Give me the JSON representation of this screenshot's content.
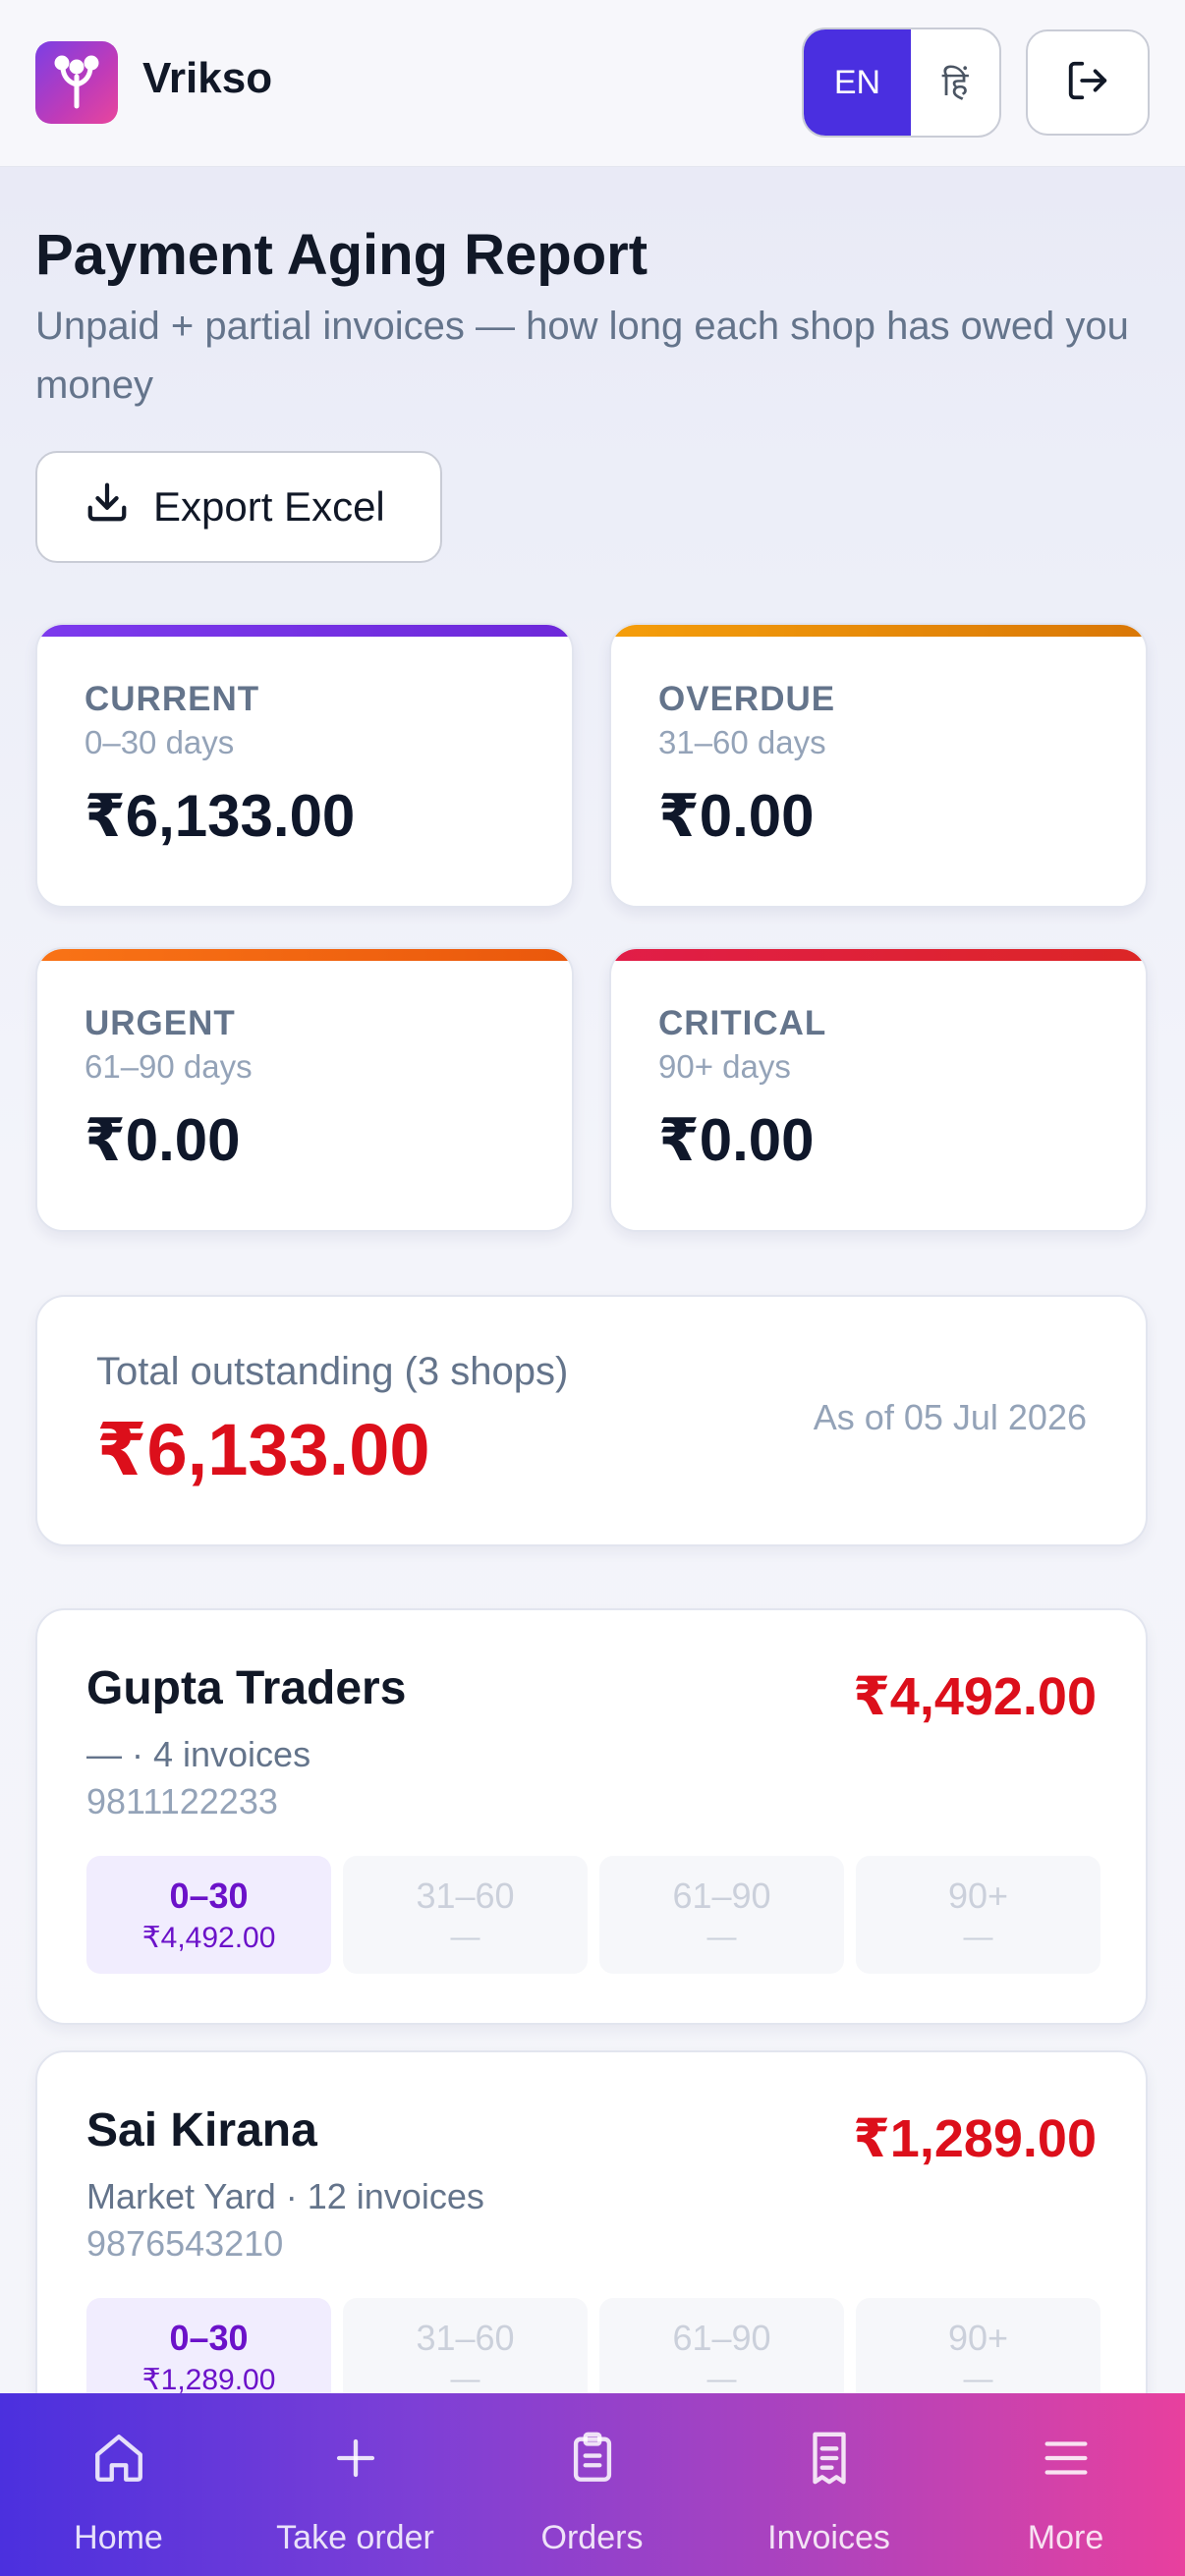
{
  "header": {
    "app_name": "Vrikso",
    "lang_en": "EN",
    "lang_hi": "हिं",
    "logo_icon": "tree-icon",
    "logout_icon": "logout-icon"
  },
  "page": {
    "title": "Payment Aging Report",
    "subtitle": "Unpaid + partial invoices — how long each shop has owed you money",
    "export_label": "Export Excel",
    "export_icon": "download-icon"
  },
  "buckets": [
    {
      "label": "CURRENT",
      "range": "0–30 days",
      "amount": "₹6,133.00",
      "color": "#7c3aed"
    },
    {
      "label": "OVERDUE",
      "range": "31–60 days",
      "amount": "₹0.00",
      "color": "#f59e0b"
    },
    {
      "label": "URGENT",
      "range": "61–90 days",
      "amount": "₹0.00",
      "color": "#f97316"
    },
    {
      "label": "CRITICAL",
      "range": "90+ days",
      "amount": "₹0.00",
      "color": "#e11d48"
    }
  ],
  "total": {
    "label": "Total outstanding (3 shops)",
    "amount": "₹6,133.00",
    "as_of": "As of 05 Jul 2026"
  },
  "shops": [
    {
      "name": "Gupta Traders",
      "amount": "₹4,492.00",
      "meta": "— · 4 invoices",
      "phone": "9811122233",
      "aging": [
        {
          "title": "0–30",
          "value": "₹4,492.00"
        },
        {
          "title": "31–60",
          "value": "—"
        },
        {
          "title": "61–90",
          "value": "—"
        },
        {
          "title": "90+",
          "value": "—"
        }
      ]
    },
    {
      "name": "Sai Kirana",
      "amount": "₹1,289.00",
      "meta": "Market Yard · 12 invoices",
      "phone": "9876543210",
      "aging": [
        {
          "title": "0–30",
          "value": "₹1,289.00"
        },
        {
          "title": "31–60",
          "value": "—"
        },
        {
          "title": "61–90",
          "value": "—"
        },
        {
          "title": "90+",
          "value": "—"
        }
      ]
    }
  ],
  "nav": [
    {
      "label": "Home",
      "icon": "home-icon"
    },
    {
      "label": "Take order",
      "icon": "plus-icon"
    },
    {
      "label": "Orders",
      "icon": "clipboard-icon"
    },
    {
      "label": "Invoices",
      "icon": "receipt-icon"
    },
    {
      "label": "More",
      "icon": "menu-icon"
    }
  ]
}
